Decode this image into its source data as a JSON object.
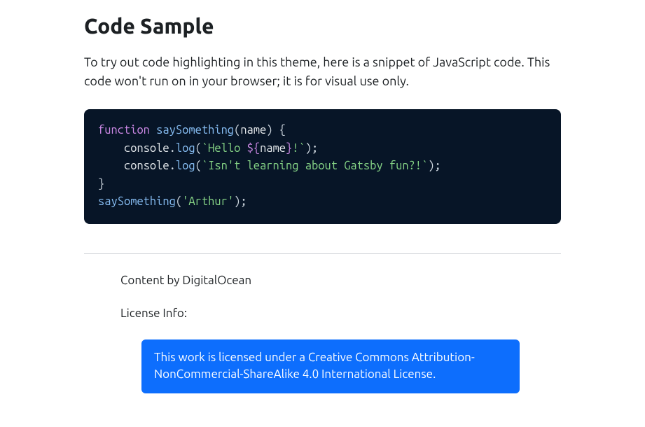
{
  "title": "Code Sample",
  "intro": "To try out code highlighting in this theme, here is a snippet of JavaScript code. This code won't run on in your browser; it is for visual use only.",
  "code": {
    "tokens": [
      {
        "cls": "tok-keyword",
        "t": "function"
      },
      {
        "cls": "tok-plain",
        "t": " "
      },
      {
        "cls": "tok-funcname",
        "t": "saySomething"
      },
      {
        "cls": "tok-punct",
        "t": "("
      },
      {
        "cls": "tok-param",
        "t": "name"
      },
      {
        "cls": "tok-punct",
        "t": ")"
      },
      {
        "cls": "tok-plain",
        "t": " "
      },
      {
        "cls": "tok-punct",
        "t": "{"
      },
      {
        "cls": "newline"
      },
      {
        "cls": "tok-plain",
        "t": "    "
      },
      {
        "cls": "tok-object",
        "t": "console"
      },
      {
        "cls": "tok-punct",
        "t": "."
      },
      {
        "cls": "tok-method",
        "t": "log"
      },
      {
        "cls": "tok-punct",
        "t": "("
      },
      {
        "cls": "tok-string",
        "t": "`Hello "
      },
      {
        "cls": "tok-interp",
        "t": "${"
      },
      {
        "cls": "tok-interpvar",
        "t": "name"
      },
      {
        "cls": "tok-interp",
        "t": "}"
      },
      {
        "cls": "tok-string",
        "t": "!`"
      },
      {
        "cls": "tok-punct",
        "t": ")"
      },
      {
        "cls": "tok-punct",
        "t": ";"
      },
      {
        "cls": "newline"
      },
      {
        "cls": "tok-plain",
        "t": "    "
      },
      {
        "cls": "tok-object",
        "t": "console"
      },
      {
        "cls": "tok-punct",
        "t": "."
      },
      {
        "cls": "tok-method",
        "t": "log"
      },
      {
        "cls": "tok-punct",
        "t": "("
      },
      {
        "cls": "tok-string",
        "t": "`Isn't learning about Gatsby fun?!`"
      },
      {
        "cls": "tok-punct",
        "t": ")"
      },
      {
        "cls": "tok-punct",
        "t": ";"
      },
      {
        "cls": "newline"
      },
      {
        "cls": "tok-punct",
        "t": "}"
      },
      {
        "cls": "newline"
      },
      {
        "cls": "tok-funcname",
        "t": "saySomething"
      },
      {
        "cls": "tok-punct",
        "t": "("
      },
      {
        "cls": "tok-string",
        "t": "'Arthur'"
      },
      {
        "cls": "tok-punct",
        "t": ")"
      },
      {
        "cls": "tok-punct",
        "t": ";"
      }
    ]
  },
  "footer": {
    "content_by": "Content by DigitalOcean",
    "license_label": "License Info:",
    "license_text": "This work is licensed under a Creative Commons Attribution-NonCommercial-ShareAlike 4.0 International License."
  }
}
